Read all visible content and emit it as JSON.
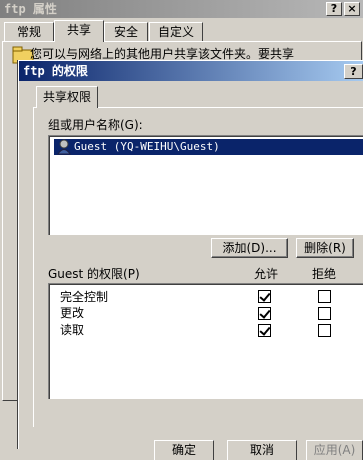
{
  "bg_window": {
    "title": "ftp 属性",
    "help_btn": "?",
    "close_btn": "×",
    "tabs": [
      "常规",
      "共享",
      "安全",
      "自定义"
    ],
    "partial_text": "您可以与网络上的其他用户共享该文件夹。要共享"
  },
  "dialog": {
    "title": "ftp 的权限",
    "help_btn": "?",
    "tab": "共享权限",
    "group_label": "组或用户名称(G):",
    "users": [
      "Guest (YQ-WEIHU\\Guest)"
    ],
    "add_button": "添加(D)...",
    "remove_button": "删除(R)",
    "perm_label": "Guest 的权限(P)",
    "allow_col": "允许",
    "deny_col": "拒绝",
    "permissions": [
      {
        "name": "完全控制",
        "allow": true,
        "deny": false
      },
      {
        "name": "更改",
        "allow": true,
        "deny": false
      },
      {
        "name": "读取",
        "allow": true,
        "deny": false
      }
    ],
    "ok_button": "确定",
    "cancel_button": "取消",
    "apply_button": "应用(A)"
  }
}
